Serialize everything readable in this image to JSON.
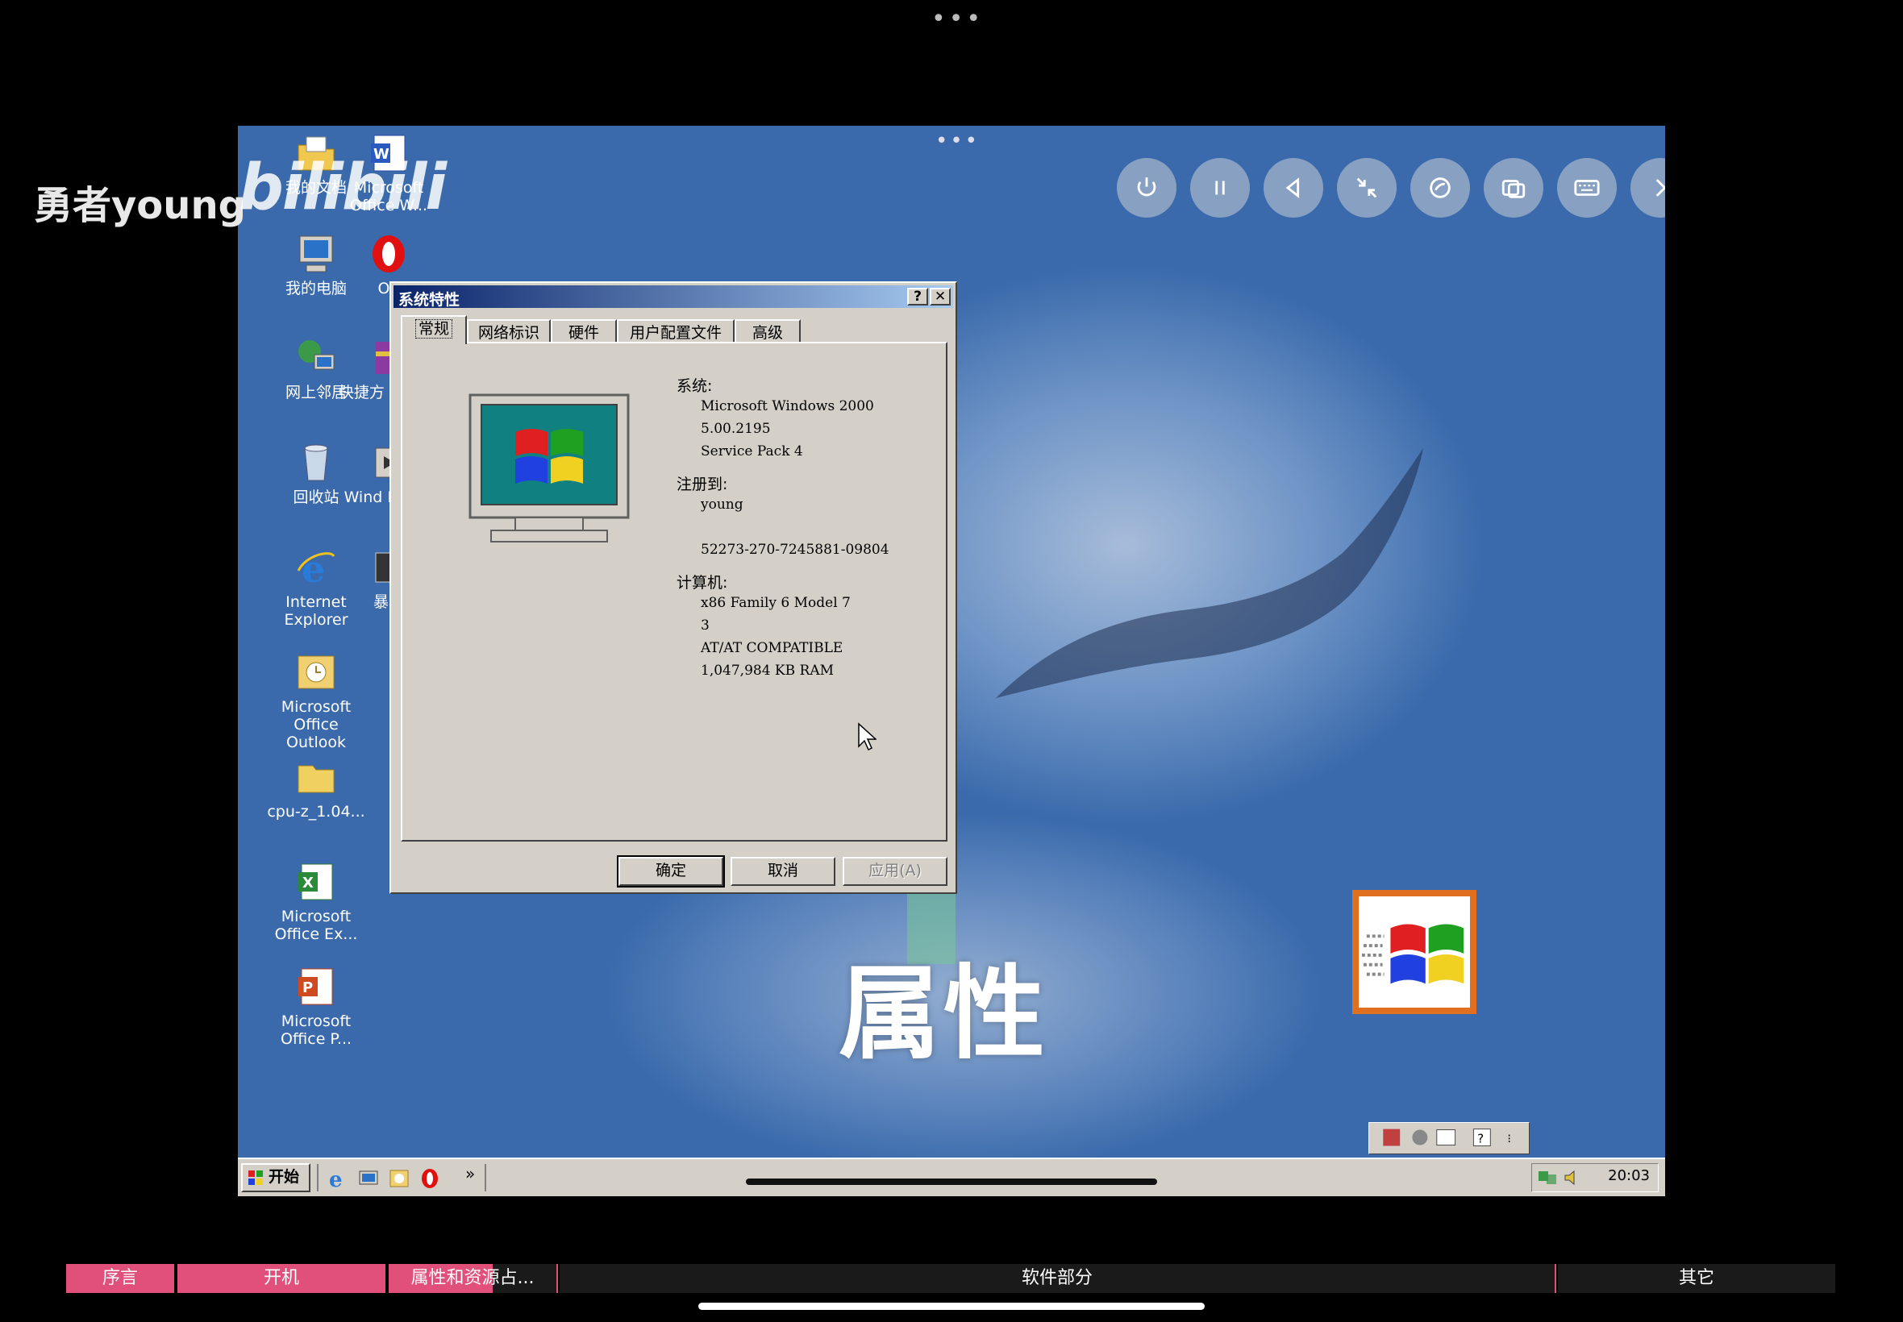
{
  "overlay": {
    "watermark_name": "勇者young",
    "watermark_logo": "bilibili",
    "big_caption": "属性"
  },
  "vm_controls": [
    "power-icon",
    "pause-icon",
    "back-icon",
    "minimize-icon",
    "disc-icon",
    "window-icon",
    "keyboard-icon",
    "next-icon"
  ],
  "desktop": {
    "icons_col1": [
      {
        "label": "我的文档",
        "icon": "folder-documents-icon"
      },
      {
        "label": "我的电脑",
        "icon": "computer-icon"
      },
      {
        "label": "网上邻居",
        "icon": "network-icon"
      },
      {
        "label": "回收站",
        "icon": "recycle-bin-icon"
      },
      {
        "label": "Internet Explorer",
        "icon": "ie-icon"
      },
      {
        "label": "Microsoft Office Outlook",
        "icon": "outlook-icon"
      },
      {
        "label": "cpu-z_1.04...",
        "icon": "folder-icon"
      },
      {
        "label": "Microsoft Office Ex...",
        "icon": "excel-icon"
      },
      {
        "label": "Microsoft Office P...",
        "icon": "powerpoint-icon"
      }
    ],
    "icons_col2": [
      {
        "label": "Microsoft Office W...",
        "icon": "word-icon"
      },
      {
        "label": "Op",
        "icon": "opera-icon"
      },
      {
        "label": "快捷方 WinRA",
        "icon": "winrar-icon"
      },
      {
        "label": "Wind Media",
        "icon": "media-player-icon"
      },
      {
        "label": "暴风",
        "icon": "storm-icon"
      }
    ]
  },
  "dialog": {
    "title": "系统特性",
    "help_btn": "?",
    "close_btn": "✕",
    "tabs": [
      "常规",
      "网络标识",
      "硬件",
      "用户配置文件",
      "高级"
    ],
    "system_label": "系统:",
    "system_lines": [
      "Microsoft Windows 2000",
      "5.00.2195",
      "Service Pack 4"
    ],
    "registered_label": "注册到:",
    "registered_lines": [
      "young",
      "",
      "52273-270-7245881-09804"
    ],
    "computer_label": "计算机:",
    "computer_lines": [
      "x86 Family 6 Model 7",
      "3",
      "AT/AT COMPATIBLE",
      "1,047,984 KB RAM"
    ],
    "buttons": {
      "ok": "确定",
      "cancel": "取消",
      "apply": "应用(A)"
    }
  },
  "taskbar": {
    "start_label": "开始",
    "quick_launch": [
      "ie-icon",
      "desktop-icon",
      "outlook-icon",
      "opera-icon"
    ],
    "more": "»",
    "clock": "20:03"
  },
  "chapters": [
    {
      "label": "序言",
      "color": "#e0507a"
    },
    {
      "label": "开机",
      "color": "#e0507a"
    },
    {
      "label": "属性和资源占...",
      "color": "#e0507a"
    },
    {
      "label": "软件部分",
      "color": "#1a1a1a"
    },
    {
      "label": "其它",
      "color": "#1a1a1a"
    }
  ]
}
